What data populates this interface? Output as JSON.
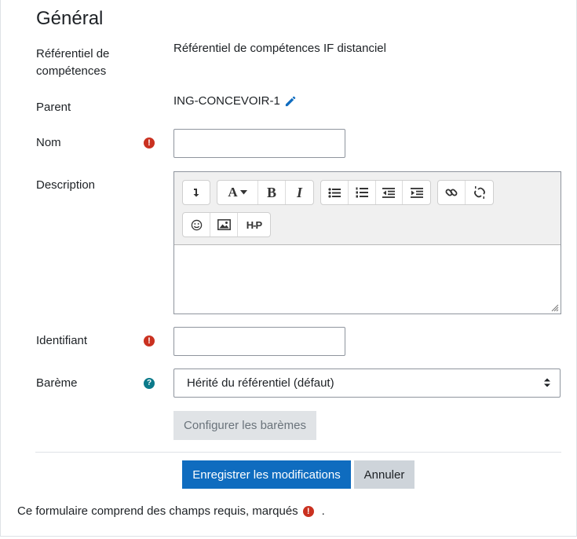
{
  "section": {
    "title": "Général"
  },
  "fields": {
    "framework": {
      "label": "Référentiel de compétences",
      "value": "Référentiel de compétences IF distanciel"
    },
    "parent": {
      "label": "Parent",
      "value": "ING-CONCEVOIR-1"
    },
    "name": {
      "label": "Nom",
      "value": ""
    },
    "description": {
      "label": "Description"
    },
    "idnumber": {
      "label": "Identifiant",
      "value": ""
    },
    "scale": {
      "label": "Barème",
      "selected": "Hérité du référentiel (défaut)"
    }
  },
  "editor": {
    "toolbar_text_icons": {
      "font": "A",
      "bold": "B",
      "italic": "I",
      "h5p": "H-P"
    }
  },
  "buttons": {
    "configure_scales": "Configurer les barèmes",
    "save": "Enregistrer les modifications",
    "cancel": "Annuler"
  },
  "footer": {
    "required_note": "Ce formulaire comprend des champs requis, marqués",
    "period": "."
  },
  "colors": {
    "primary": "#0f6cbf",
    "required": "#ca3120",
    "help": "#0b7a8a"
  }
}
